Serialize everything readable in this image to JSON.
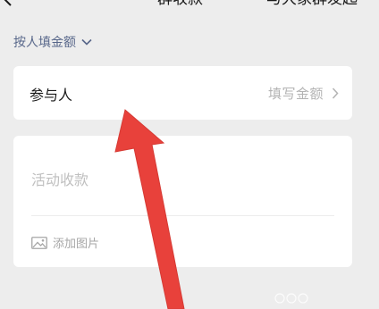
{
  "header": {
    "title": "群收款",
    "right_action": "与大家群发起"
  },
  "mode_selector": {
    "label": "按人填金额"
  },
  "participant_row": {
    "label": "参与人",
    "placeholder": "填写金额"
  },
  "note_card": {
    "placeholder": "活动收款",
    "add_image_label": "添加图片"
  },
  "colors": {
    "background": "#ededed",
    "card": "#ffffff",
    "link_blue": "#58678a",
    "placeholder_gray": "#b3b3b3",
    "annotation_red": "#e8413b"
  },
  "icons": {
    "back": "back-chevron-icon",
    "mode_dropdown": "chevron-down-icon",
    "row_arrow": "chevron-right-icon",
    "add_image": "image-icon"
  },
  "annotation": {
    "type": "red-arrow"
  }
}
